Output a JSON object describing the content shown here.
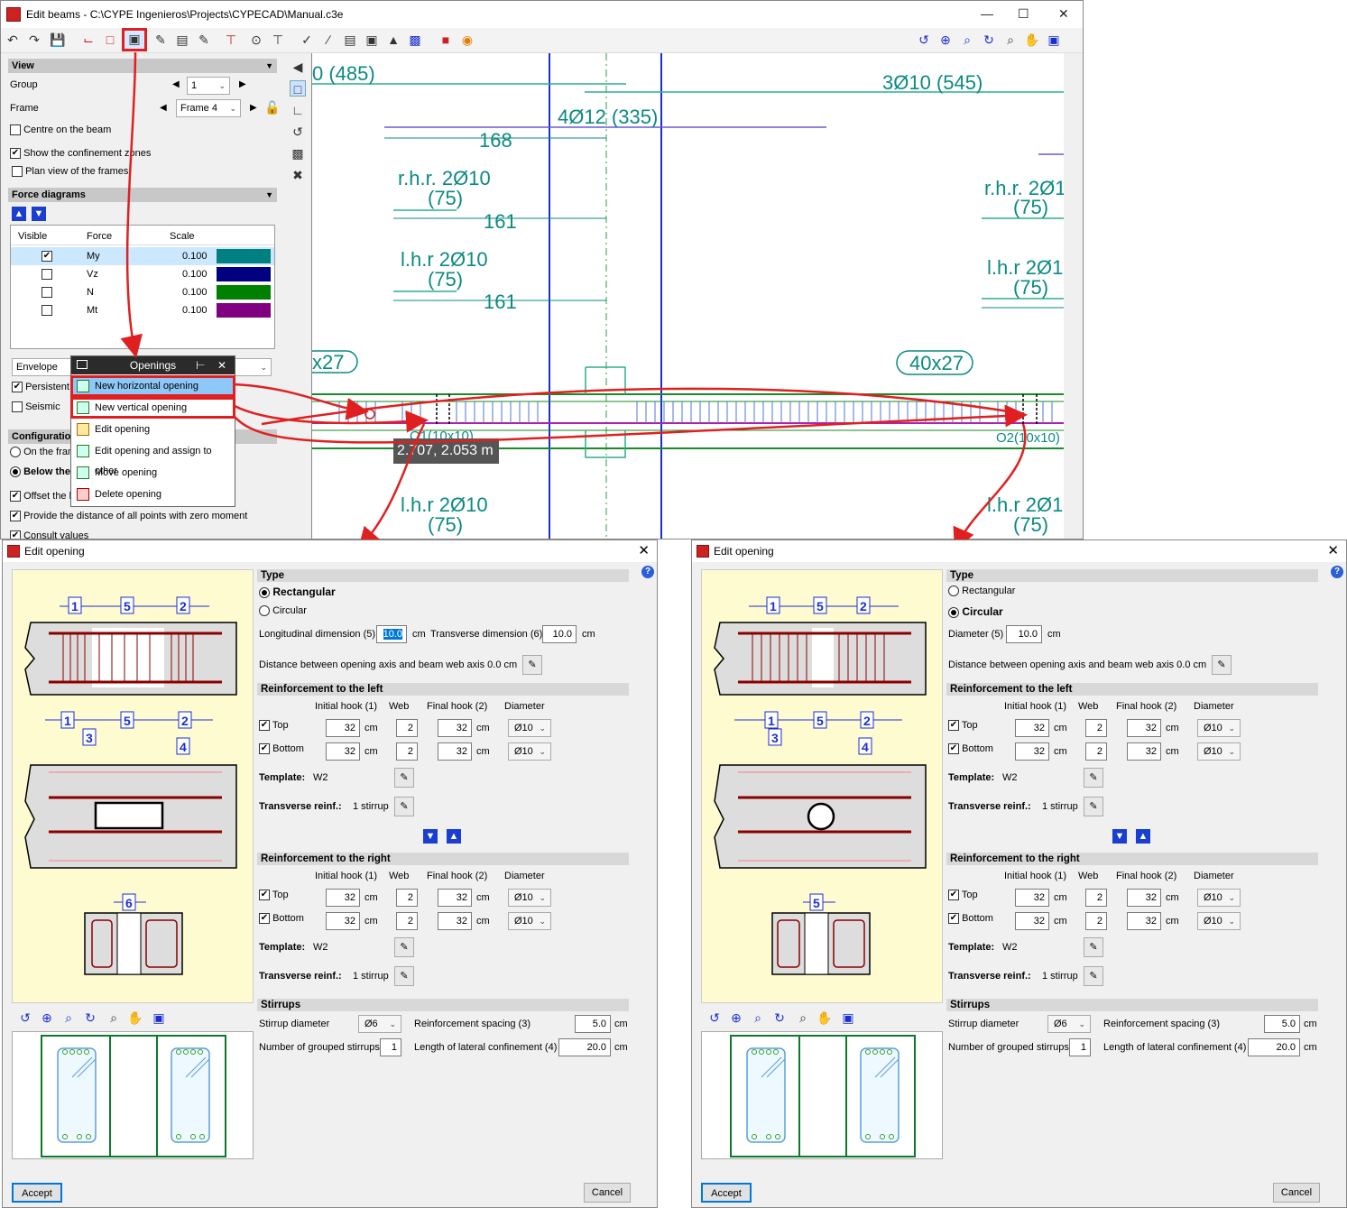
{
  "window": {
    "title": "Edit beams - C:\\CYPE Ingenieros\\Projects\\CYPECAD\\Manual.c3e"
  },
  "view_section": {
    "header": "View",
    "group_label": "Group",
    "group_value": "1",
    "frame_label": "Frame",
    "frame_value": "Frame 4",
    "centre_on_beam": "Centre on the beam",
    "show_confinement": "Show the confinement zones",
    "plan_view": "Plan view of the frames"
  },
  "force_section": {
    "header": "Force diagrams",
    "columns": [
      "Visible",
      "Force",
      "Scale"
    ],
    "rows": [
      {
        "force": "My",
        "scale": "0.100",
        "checked": "✔",
        "color": "#008080"
      },
      {
        "force": "Vz",
        "scale": "0.100",
        "checked": "",
        "color": "#000080"
      },
      {
        "force": "N",
        "scale": "0.100",
        "checked": "",
        "color": "#008000"
      },
      {
        "force": "Mt",
        "scale": "0.100",
        "checked": "",
        "color": "#800080"
      }
    ],
    "envelope": "Envelope",
    "persistent": "Persistent",
    "seismic": "Seismic"
  },
  "config_section": {
    "header": "Configuration",
    "on_frame": "On the frame",
    "below": "Below the",
    "offset": "Offset the b",
    "provide_distance": "Provide the distance of all points with zero moment",
    "consult": "Consult values"
  },
  "openings_menu": {
    "title": "Openings",
    "items": [
      "New horizontal opening",
      "New vertical opening",
      "Edit opening",
      "Edit opening and assign to other",
      "Move opening",
      "Delete opening"
    ]
  },
  "canvas": {
    "labels": {
      "a": "0 (485)",
      "b": "3Ø10 (545)",
      "c": "4Ø12 (335)",
      "d": "168",
      "e": "r.h.r. 2Ø10",
      "f": "(75)",
      "g": "161",
      "h": "r.h.r. 2Ø1",
      "i": "(75)",
      "j": "l.h.r 2Ø10",
      "k": "(75)",
      "l": "161",
      "m": "l.h.r 2Ø1",
      "n": "(75)",
      "o": "x27",
      "p": "40x27",
      "q": "O1(10x10)",
      "r": "O2(10x10)",
      "s": "l.h.r 2Ø10",
      "t": "(75)",
      "u": "l.h.r 2Ø1",
      "v": "(75)"
    },
    "tooltip": "2.707, 2.053 m"
  },
  "dialog_left": {
    "title": "Edit opening",
    "type_header": "Type",
    "rect": "Rectangular",
    "circ": "Circular",
    "long_dim_label": "Longitudinal dimension (5)",
    "long_dim": "10.0",
    "unit_cm": "cm",
    "trans_dim_label": "Transverse dimension (6)",
    "trans_dim": "10.0",
    "distance": "Distance between opening axis and beam web axis  0.0 cm",
    "reinf_left": "Reinforcement to the left",
    "reinf_right": "Reinforcement to the right",
    "col_initial": "Initial hook (1)",
    "col_web": "Web",
    "col_final": "Final hook (2)",
    "col_diam": "Diameter",
    "top": "Top",
    "bottom": "Bottom",
    "v32": "32",
    "v2": "2",
    "diam": "Ø10",
    "template_label": "Template:",
    "template_val": "W2",
    "trans_label": "Transverse reinf.:",
    "trans_val": "1 stirrup",
    "stirrups": "Stirrups",
    "stirrup_diam_label": "Stirrup diameter",
    "stirrup_diam": "Ø6",
    "spacing_label": "Reinforcement spacing (3)",
    "spacing": "5.0",
    "grouped_label": "Number of grouped stirrups",
    "grouped": "1",
    "lateral_label": "Length of lateral confinement (4)",
    "lateral": "20.0",
    "accept": "Accept",
    "cancel": "Cancel",
    "fig_nums": [
      "1",
      "5",
      "2",
      "1",
      "5",
      "2",
      "3",
      "4",
      "6"
    ]
  },
  "dialog_right": {
    "title": "Edit opening",
    "type_header": "Type",
    "rect": "Rectangular",
    "circ": "Circular",
    "diam_label": "Diameter (5)",
    "diam_val": "10.0",
    "unit_cm": "cm",
    "distance": "Distance between opening axis and beam web axis  0.0 cm",
    "reinf_left": "Reinforcement to the left",
    "reinf_right": "Reinforcement to the right",
    "col_initial": "Initial hook (1)",
    "col_web": "Web",
    "col_final": "Final hook (2)",
    "col_diam": "Diameter",
    "top": "Top",
    "bottom": "Bottom",
    "v32": "32",
    "v2": "2",
    "diam": "Ø10",
    "template_label": "Template:",
    "template_val": "W2",
    "trans_label": "Transverse reinf.:",
    "trans_val": "1 stirrup",
    "stirrups": "Stirrups",
    "stirrup_diam_label": "Stirrup diameter",
    "stirrup_diam": "Ø6",
    "spacing_label": "Reinforcement spacing (3)",
    "spacing": "5.0",
    "grouped_label": "Number of grouped stirrups",
    "grouped": "1",
    "lateral_label": "Length of lateral confinement (4)",
    "lateral": "20.0",
    "accept": "Accept",
    "cancel": "Cancel",
    "fig_nums": [
      "1",
      "5",
      "2",
      "1",
      "5",
      "2",
      "3",
      "4",
      "5"
    ]
  },
  "colors": {
    "accent_red": "#e02020",
    "teal": "#0b8a82",
    "blue": "#1a2fd0",
    "yellow_preview": "#fffbd0"
  }
}
